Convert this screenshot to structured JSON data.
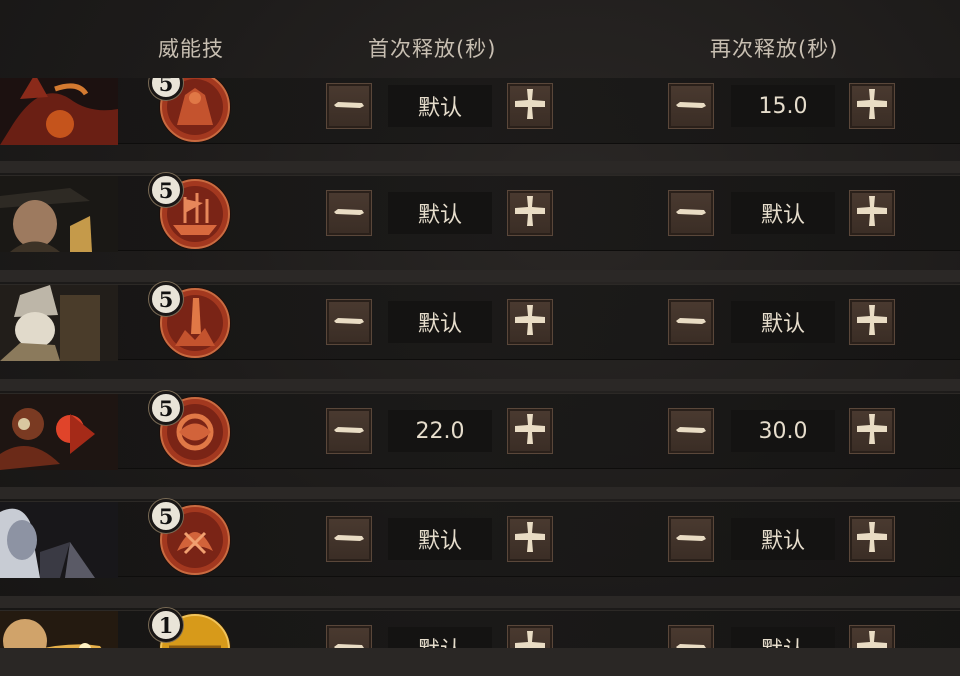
{
  "headers": {
    "skill": "威能技",
    "first_release": "首次释放(秒)",
    "repeat_release": "再次释放(秒)"
  },
  "rows": [
    {
      "badge": "5",
      "first_value": "默认",
      "repeat_value": "15.0",
      "icon": "demon-portrait-icon",
      "skill_icon": "warband-skill-icon"
    },
    {
      "badge": "5",
      "first_value": "默认",
      "repeat_value": "默认",
      "icon": "pirate-portrait-icon",
      "skill_icon": "ship-skill-icon"
    },
    {
      "badge": "5",
      "first_value": "默认",
      "repeat_value": "默认",
      "icon": "dwarf-portrait-icon",
      "skill_icon": "blade-skill-icon"
    },
    {
      "badge": "5",
      "first_value": "22.0",
      "repeat_value": "30.0",
      "icon": "engineer-portrait-icon",
      "skill_icon": "vortex-skill-icon"
    },
    {
      "badge": "5",
      "first_value": "默认",
      "repeat_value": "默认",
      "icon": "elf-portrait-icon",
      "skill_icon": "flame-skill-icon"
    },
    {
      "badge": "1",
      "first_value": "默认",
      "repeat_value": "默认",
      "icon": "cat-portrait-icon",
      "skill_icon": "gold-skill-icon"
    }
  ],
  "colors": {
    "button_bg": "#3f3128",
    "icon_red": "#b5452a",
    "cross": "#e9dcc4",
    "value_bg": "#141312"
  }
}
